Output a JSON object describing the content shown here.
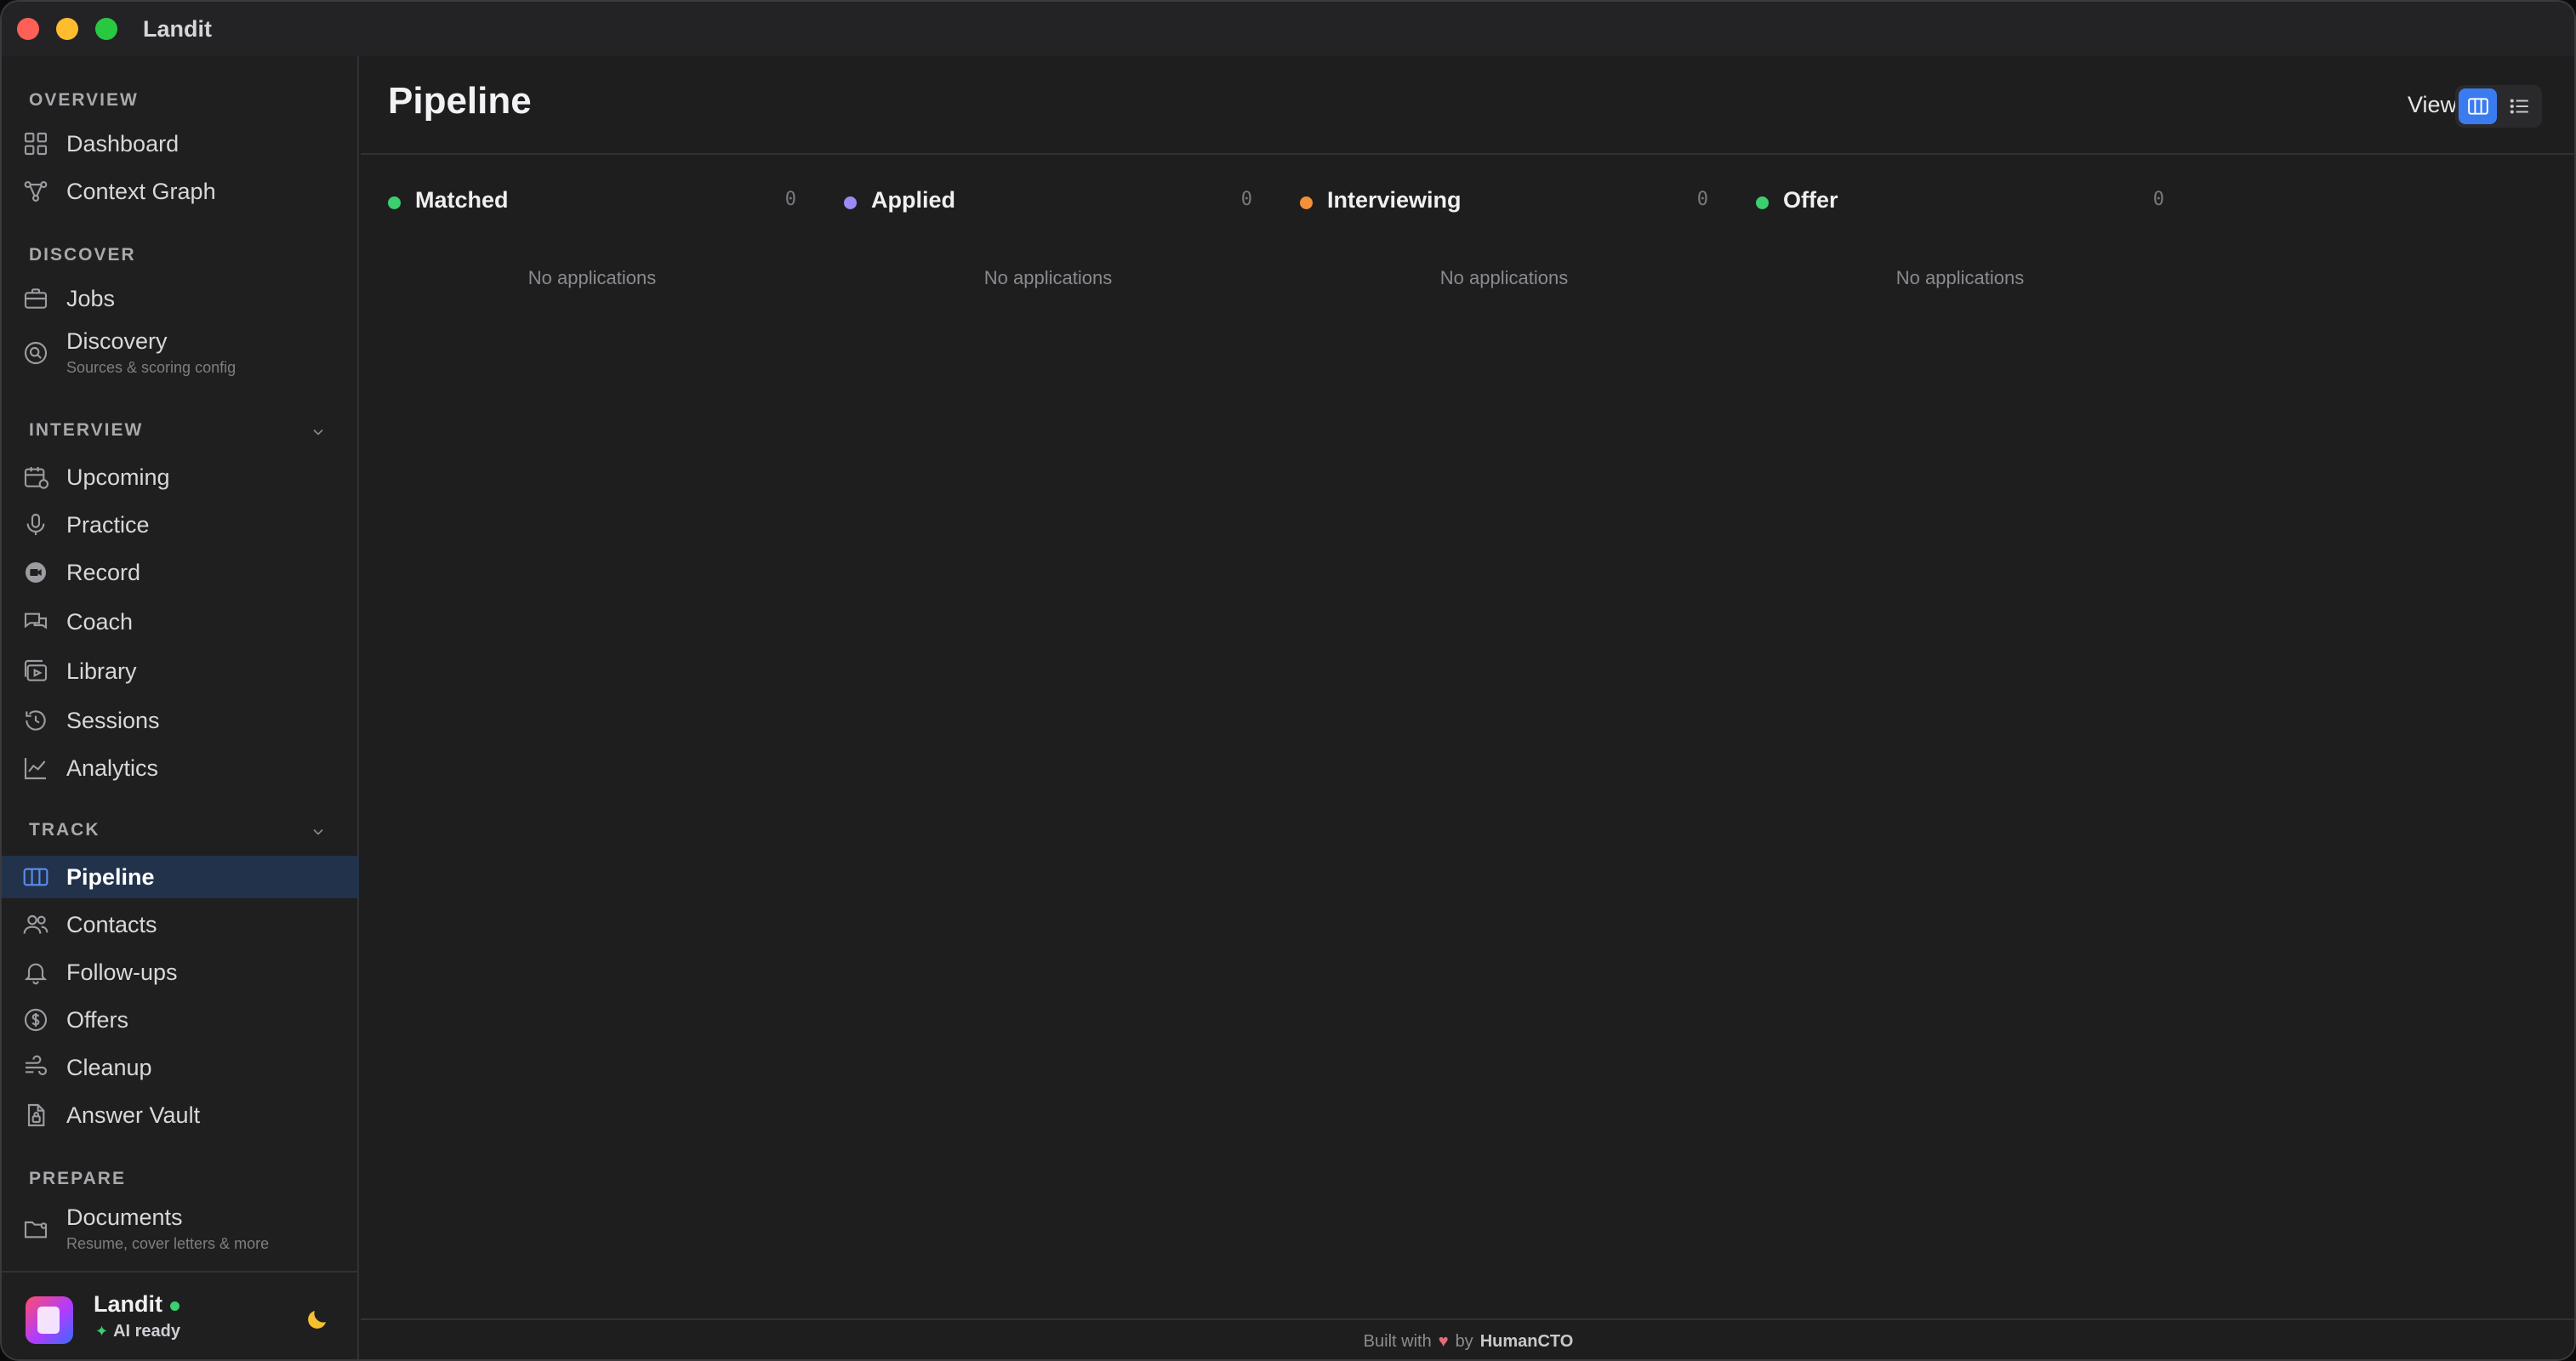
{
  "window": {
    "title": "Landit"
  },
  "sidebar": {
    "sections": {
      "overview": "OVERVIEW",
      "discover": "DISCOVER",
      "interview": "INTERVIEW",
      "track": "TRACK",
      "prepare": "PREPARE"
    },
    "items": {
      "dashboard": {
        "label": "Dashboard",
        "icon": "grid-icon"
      },
      "context_graph": {
        "label": "Context Graph",
        "icon": "graph-icon"
      },
      "jobs": {
        "label": "Jobs",
        "icon": "briefcase-icon"
      },
      "discovery": {
        "label": "Discovery",
        "sub": "Sources & scoring config",
        "icon": "search-icon"
      },
      "upcoming": {
        "label": "Upcoming",
        "icon": "calendar-icon"
      },
      "practice": {
        "label": "Practice",
        "icon": "microphone-icon"
      },
      "record": {
        "label": "Record",
        "icon": "record-icon"
      },
      "coach": {
        "label": "Coach",
        "icon": "chat-icon"
      },
      "library": {
        "label": "Library",
        "icon": "video-library-icon"
      },
      "sessions": {
        "label": "Sessions",
        "icon": "history-icon"
      },
      "analytics": {
        "label": "Analytics",
        "icon": "chart-icon"
      },
      "pipeline": {
        "label": "Pipeline",
        "icon": "columns-icon",
        "active": true
      },
      "contacts": {
        "label": "Contacts",
        "icon": "people-icon"
      },
      "followups": {
        "label": "Follow-ups",
        "icon": "bell-icon"
      },
      "offers": {
        "label": "Offers",
        "icon": "dollar-icon"
      },
      "cleanup": {
        "label": "Cleanup",
        "icon": "wind-icon"
      },
      "answer_vault": {
        "label": "Answer Vault",
        "icon": "document-lock-icon"
      },
      "documents": {
        "label": "Documents",
        "sub": "Resume, cover letters & more",
        "icon": "folder-icon"
      }
    },
    "footer": {
      "brand": "Landit",
      "status": "AI ready"
    }
  },
  "header": {
    "title": "Pipeline",
    "view_label": "View"
  },
  "columns": [
    {
      "title": "Matched",
      "count": "0",
      "empty": "No applications",
      "color": "#3ccf6e"
    },
    {
      "title": "Applied",
      "count": "0",
      "empty": "No applications",
      "color": "#9b8cf5"
    },
    {
      "title": "Interviewing",
      "count": "0",
      "empty": "No applications",
      "color": "#f5903a"
    },
    {
      "title": "Offer",
      "count": "0",
      "empty": "No applications",
      "color": "#3ccf6e"
    }
  ],
  "footer": {
    "built_with": "Built with",
    "by": "by",
    "brand": "HumanCTO"
  },
  "colors": {
    "accent": "#3b7bf0",
    "active_bg": "#22324b"
  }
}
